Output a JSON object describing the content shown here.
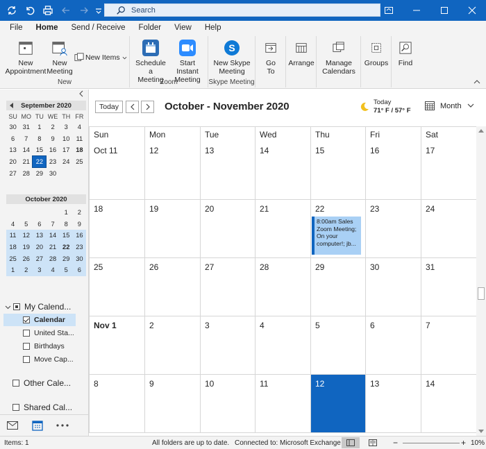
{
  "titlebar": {
    "search_placeholder": "Search"
  },
  "menu": {
    "tabs": [
      "File",
      "Home",
      "Send / Receive",
      "Folder",
      "View",
      "Help"
    ],
    "active": "Home"
  },
  "ribbon": {
    "new_group": {
      "label": "New",
      "new_appointment": [
        "New",
        "Appointment"
      ],
      "new_meeting": [
        "New",
        "Meeting"
      ],
      "new_items": "New Items"
    },
    "zoom_group": {
      "label": "Zoom",
      "schedule_meeting": [
        "Schedule a",
        "Meeting"
      ],
      "start_instant": [
        "Start Instant",
        "Meeting"
      ]
    },
    "skype_group": {
      "label": "Skype Meeting",
      "new_skype": [
        "New Skype",
        "Meeting"
      ]
    },
    "goto": [
      "Go",
      "To"
    ],
    "arrange": "Arrange",
    "manage_calendars": [
      "Manage",
      "Calendars"
    ],
    "groups": "Groups",
    "find": "Find"
  },
  "minical_sep": {
    "title": "September 2020",
    "dow": [
      "SU",
      "MO",
      "TU",
      "WE",
      "TH",
      "FR"
    ],
    "rows": [
      [
        "30",
        "31",
        "1",
        "2",
        "3",
        "4"
      ],
      [
        "6",
        "7",
        "8",
        "9",
        "10",
        "11"
      ],
      [
        "13",
        "14",
        "15",
        "16",
        "17",
        "18"
      ],
      [
        "20",
        "21",
        "22",
        "23",
        "24",
        "25"
      ],
      [
        "27",
        "28",
        "29",
        "30",
        "",
        ""
      ]
    ],
    "today": "22"
  },
  "minical_oct": {
    "title": "October 2020",
    "rows": [
      [
        "",
        "",
        "",
        "",
        "1",
        "2"
      ],
      [
        "4",
        "5",
        "6",
        "7",
        "8",
        "9"
      ],
      [
        "11",
        "12",
        "13",
        "14",
        "15",
        "16"
      ],
      [
        "18",
        "19",
        "20",
        "21",
        "22",
        "23"
      ],
      [
        "25",
        "26",
        "27",
        "28",
        "29",
        "30"
      ],
      [
        "1",
        "2",
        "3",
        "4",
        "5",
        "6"
      ]
    ]
  },
  "folders": {
    "my_calendars": "My Calend...",
    "calendar": "Calendar",
    "united_states": "United Sta...",
    "birthdays": "Birthdays",
    "move_cap": "Move Cap...",
    "other_calendars": "Other Cale...",
    "shared_calendars": "Shared Cal..."
  },
  "calendar": {
    "today_btn": "Today",
    "title": "October - November 2020",
    "weather_label": "Today",
    "weather_temp": "71° F / 57° F",
    "view": "Month",
    "days": [
      "Sun",
      "Mon",
      "Tue",
      "Wed",
      "Thu",
      "Fri",
      "Sat"
    ],
    "weeks": [
      [
        "Oct 11",
        "12",
        "13",
        "14",
        "15",
        "16",
        "17"
      ],
      [
        "18",
        "19",
        "20",
        "21",
        "22",
        "23",
        "24"
      ],
      [
        "25",
        "26",
        "27",
        "28",
        "29",
        "30",
        "31"
      ],
      [
        "Nov 1",
        "2",
        "3",
        "4",
        "5",
        "6",
        "7"
      ],
      [
        "8",
        "9",
        "10",
        "11",
        "12",
        "13",
        "14"
      ]
    ],
    "event_text": "8:00am Sales Zoom Meeting; On your computer!; jb..."
  },
  "status": {
    "items": "Items: 1",
    "sync": "All folders are up to date.",
    "connection": "Connected to: Microsoft Exchange",
    "zoom": "10%"
  },
  "colors": {
    "accent": "#1065c0",
    "selection": "#cde3f7",
    "event": "#a9d0f5"
  }
}
